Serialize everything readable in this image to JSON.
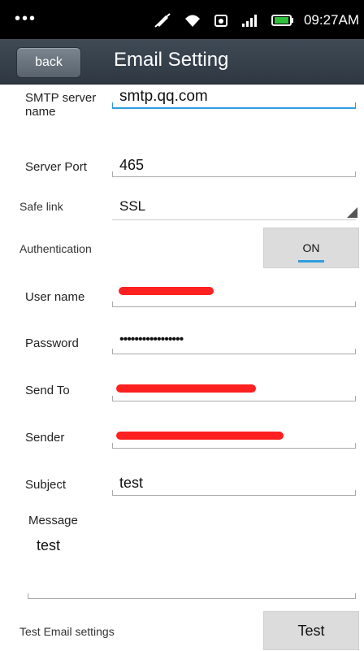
{
  "status": {
    "time": "09:27AM"
  },
  "header": {
    "back_label": "back",
    "title": "Email Setting"
  },
  "form": {
    "smtp_label": "SMTP server name",
    "smtp_value": "smtp.qq.com",
    "port_label": "Server Port",
    "port_value": "465",
    "safelink_label": "Safe link",
    "safelink_value": "SSL",
    "auth_label": "Authentication",
    "auth_toggle": "ON",
    "username_label": "User name",
    "password_label": "Password",
    "password_value": "•••••••••••••••••",
    "sendto_label": "Send To",
    "sender_label": "Sender",
    "subject_label": "Subject",
    "subject_value": "test",
    "message_label": "Message",
    "message_value": "test",
    "test_label": "Test Email settings",
    "test_button": "Test"
  },
  "colors": {
    "accent": "#2f9de0",
    "redaction": "#ff2020",
    "titlebar": "#36404a"
  }
}
